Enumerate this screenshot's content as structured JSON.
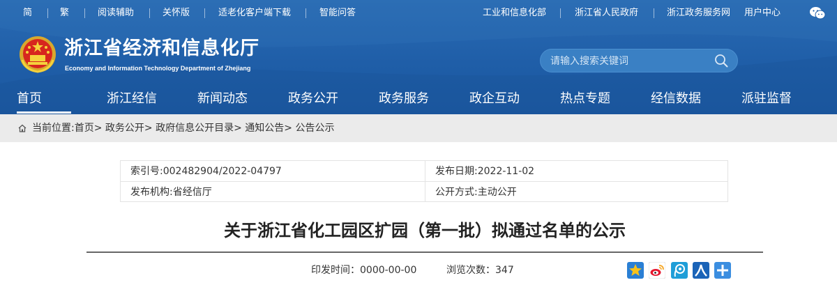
{
  "topbar": {
    "left_links": [
      "简",
      "繁",
      "阅读辅助",
      "关怀版",
      "适老化客户端下载",
      "智能问答"
    ],
    "right_links": [
      "工业和信息化部",
      "浙江省人民政府",
      "浙江政务服务网",
      "用户中心"
    ],
    "wechat_icon": "wechat-icon"
  },
  "site": {
    "title": "浙江省经济和信息化厅",
    "subtitle": "Economy and Information Technology Department of Zhejiang",
    "emblem_icon": "national-emblem-icon"
  },
  "search": {
    "placeholder": "请输入搜索关键词",
    "icon": "search-icon"
  },
  "nav": {
    "items": [
      "首页",
      "浙江经信",
      "新闻动态",
      "政务公开",
      "政务服务",
      "政企互动",
      "热点专题",
      "经信数据",
      "派驻监督"
    ],
    "active_index": 0
  },
  "breadcrumb": {
    "prefix": "当前位置:",
    "items": [
      "首页",
      "政务公开",
      "政府信息公开目录",
      "通知公告",
      "公告公示"
    ],
    "separator": ">"
  },
  "info": {
    "index_label": "索引号:",
    "index_value": "002482904/2022-04797",
    "date_label": "发布日期:",
    "date_value": "2022-11-02",
    "org_label": "发布机构:",
    "org_value": "省经信厅",
    "mode_label": "公开方式:",
    "mode_value": "主动公开"
  },
  "article": {
    "title": "关于浙江省化工园区扩园（第一批）拟通过名单的公示",
    "issue_time_label": "印发时间：",
    "issue_time_value": "0000-00-00",
    "views_label": "浏览次数：",
    "views_value": "347"
  },
  "share_icons": [
    "qzone-star-icon",
    "weibo-icon",
    "tencent-weibo-icon",
    "renren-icon",
    "more-share-plus-icon"
  ],
  "colors": {
    "header_blue": "#1f5ea8",
    "breadcrumb_bg": "#ebebeb",
    "search_bg": "#3a80c4"
  }
}
